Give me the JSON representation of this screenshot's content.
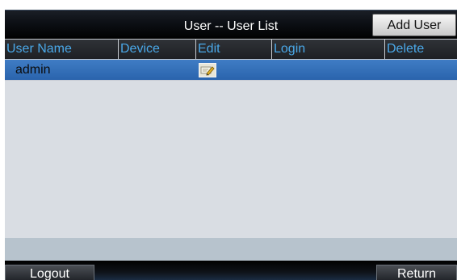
{
  "header": {
    "title": "User -- User List",
    "add_user_label": "Add User"
  },
  "table": {
    "columns": [
      "User Name",
      "Device",
      "Edit",
      "Login",
      "Delete"
    ],
    "rows": [
      {
        "user_name": "admin",
        "device": "",
        "login": "",
        "delete": ""
      }
    ]
  },
  "footer": {
    "logout_label": "Logout",
    "return_label": "Return"
  },
  "colors": {
    "header_text": "#4aa8e8",
    "selected_row": "#3a75bf"
  },
  "icons": [
    "edit-icon",
    "mouse-cursor-icon"
  ]
}
